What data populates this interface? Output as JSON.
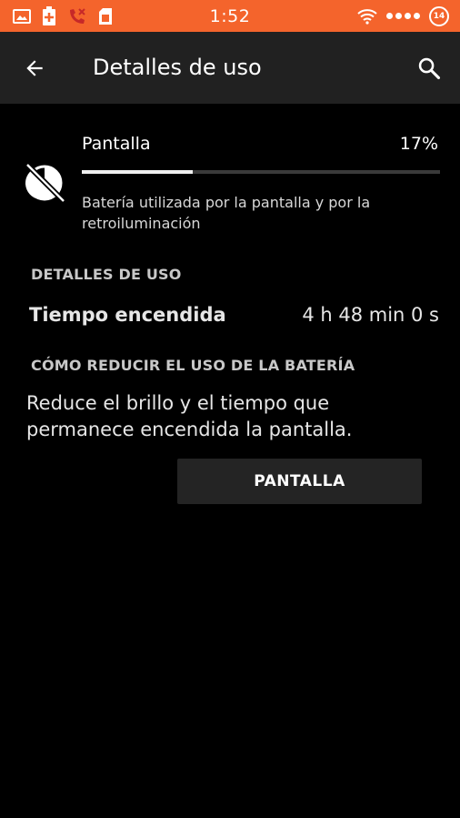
{
  "status_bar": {
    "time": "1:52",
    "background_color": "#f4642c",
    "left_icons": [
      "image-icon",
      "battery-plus-icon",
      "missed-call-icon",
      "sim-card-icon"
    ],
    "right_icons": [
      "wifi-icon",
      "signal-dots-icon"
    ],
    "badge": "14"
  },
  "app_bar": {
    "title": "Detalles de uso",
    "back_icon": "arrow-back-icon",
    "search_icon": "search-icon",
    "background_color": "#212121"
  },
  "usage": {
    "icon": "display-brightness-off-icon",
    "name": "Pantalla",
    "percent_label": "17%",
    "percent_value": 0.31,
    "description": "Batería utilizada por la pantalla y por la retroiluminación"
  },
  "details": {
    "header": "DETALLES DE USO",
    "rows": [
      {
        "label": "Tiempo encendida",
        "value": "4 h 48 min 0 s"
      }
    ]
  },
  "reduce": {
    "header": "CÓMO REDUCIR EL USO DE LA BATERÍA",
    "tip": "Reduce el brillo y el tiempo que permanece encendida la pantalla.",
    "button_label": "PANTALLA"
  }
}
